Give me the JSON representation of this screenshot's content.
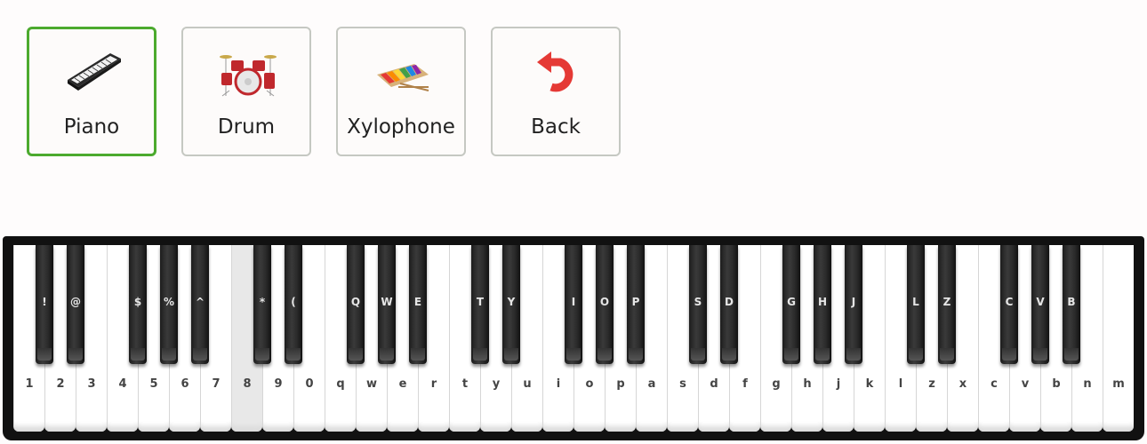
{
  "instruments": [
    {
      "label": "Piano",
      "icon": "piano-keyboard-icon",
      "selected": true
    },
    {
      "label": "Drum",
      "icon": "drum-kit-icon",
      "selected": false
    },
    {
      "label": "Xylophone",
      "icon": "xylophone-icon",
      "selected": false
    },
    {
      "label": "Back",
      "icon": "undo-arrow-icon",
      "selected": false
    }
  ],
  "colors": {
    "selected_border": "#4caa2e",
    "button_border": "#c5c8c2",
    "back_arrow": "#e53935"
  },
  "white_keys": [
    "1",
    "2",
    "3",
    "4",
    "5",
    "6",
    "7",
    "8",
    "9",
    "0",
    "q",
    "w",
    "e",
    "r",
    "t",
    "y",
    "u",
    "i",
    "o",
    "p",
    "a",
    "s",
    "d",
    "f",
    "g",
    "h",
    "j",
    "k",
    "l",
    "z",
    "x",
    "c",
    "v",
    "b",
    "n",
    "m"
  ],
  "pressed_white_key": "8",
  "black_keys": [
    "!",
    "@",
    "$",
    "%",
    "^",
    "*",
    "(",
    "Q",
    "W",
    "E",
    "T",
    "Y",
    "I",
    "O",
    "P",
    "S",
    "D",
    "G",
    "H",
    "J",
    "L",
    "Z",
    "C",
    "V",
    "B"
  ]
}
